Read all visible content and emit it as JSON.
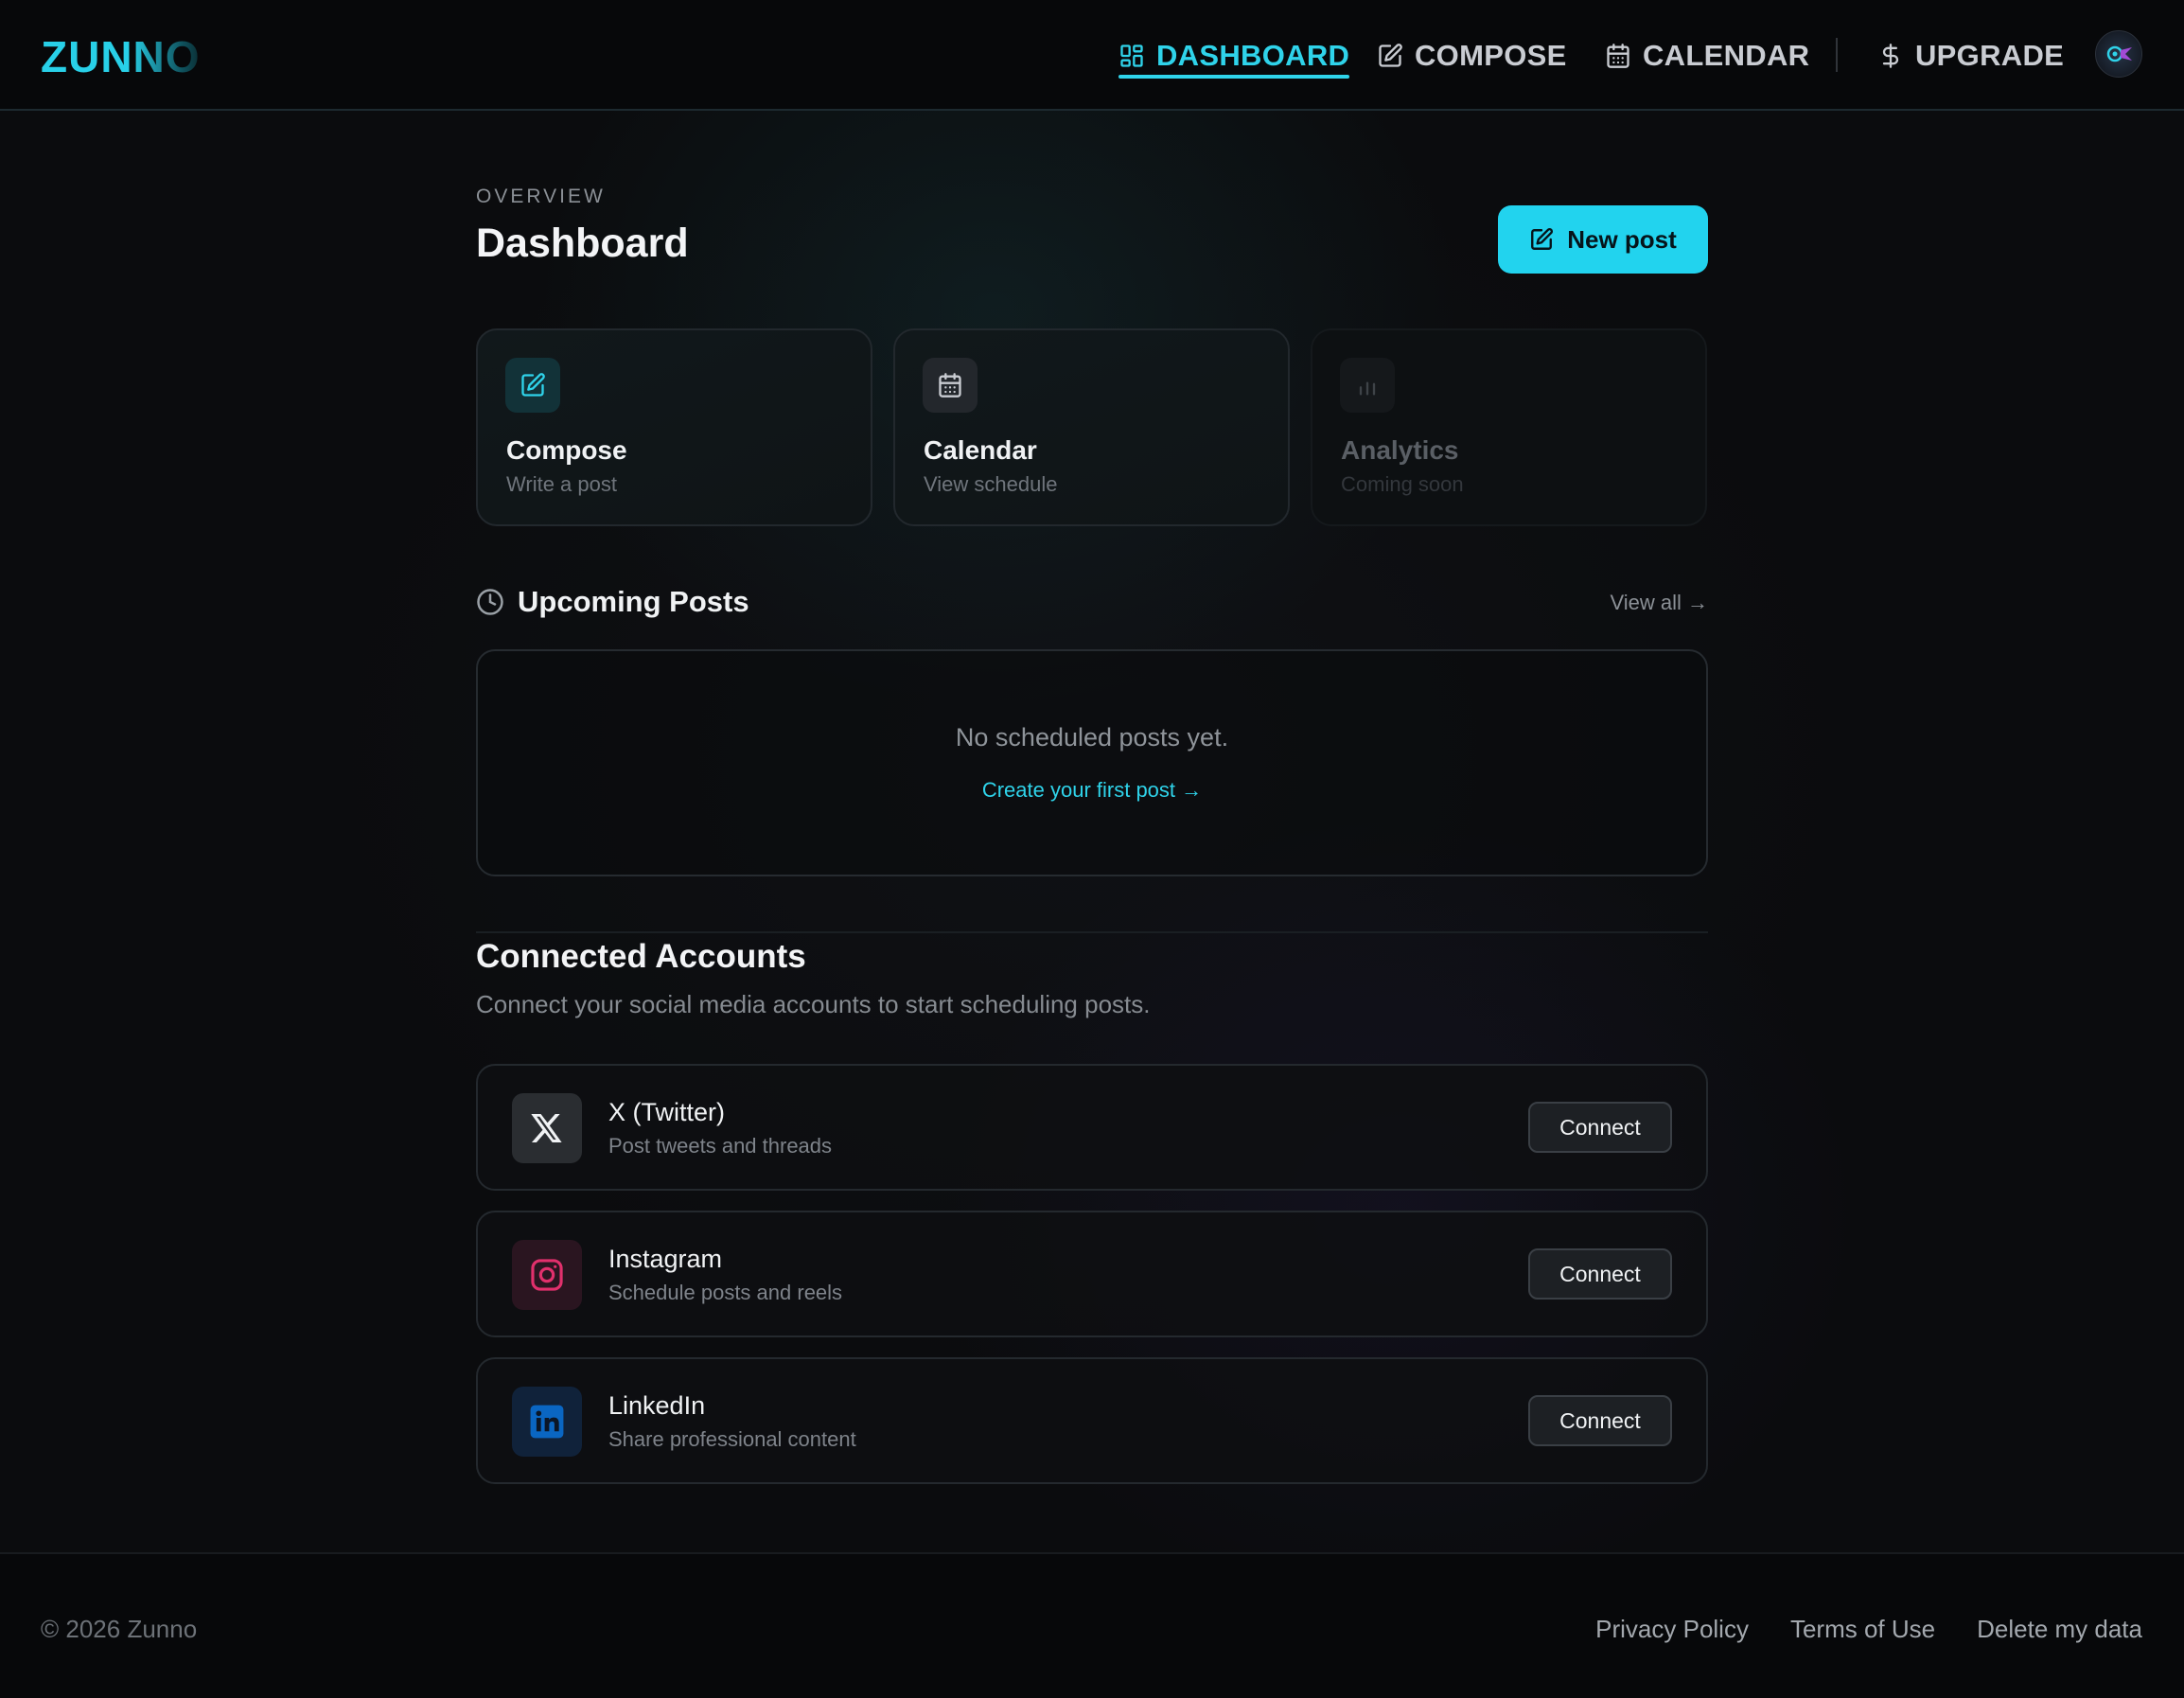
{
  "brand": {
    "logo": "ZUNNO"
  },
  "nav": {
    "items": [
      {
        "label": "DASHBOARD",
        "icon": "grid-icon",
        "active": true
      },
      {
        "label": "COMPOSE",
        "icon": "pencil-square-icon",
        "active": false
      },
      {
        "label": "CALENDAR",
        "icon": "calendar-icon",
        "active": false
      },
      {
        "label": "UPGRADE",
        "icon": "dollar-icon",
        "active": false
      }
    ],
    "avatar": "avatar"
  },
  "header": {
    "overline": "OVERVIEW",
    "title": "Dashboard",
    "new_post_label": "New post"
  },
  "cards": [
    {
      "title": "Compose",
      "subtitle": "Write a post",
      "icon": "pencil-square-icon"
    },
    {
      "title": "Calendar",
      "subtitle": "View schedule",
      "icon": "calendar-icon"
    },
    {
      "title": "Analytics",
      "subtitle": "Coming soon",
      "icon": "bar-chart-icon",
      "disabled": true
    }
  ],
  "upcoming": {
    "title": "Upcoming Posts",
    "view_all": "View all →",
    "empty_text": "No scheduled posts yet.",
    "empty_link": "Create your first post →"
  },
  "accounts": {
    "title": "Connected Accounts",
    "subtitle": "Connect your social media accounts to start scheduling posts.",
    "items": [
      {
        "name": "X (Twitter)",
        "description": "Post tweets and threads",
        "button": "Connect",
        "icon": "x-logo-icon"
      },
      {
        "name": "Instagram",
        "description": "Schedule posts and reels",
        "button": "Connect",
        "icon": "instagram-icon"
      },
      {
        "name": "LinkedIn",
        "description": "Share professional content",
        "button": "Connect",
        "icon": "linkedin-icon"
      }
    ]
  },
  "footer": {
    "copyright": "© 2026 Zunno",
    "links": [
      "Privacy Policy",
      "Terms of Use",
      "Delete my data"
    ]
  },
  "colors": {
    "accent": "#22d3ee",
    "background": "#0b0c0e",
    "instagram": "#e1306c",
    "linkedin": "#0a66c2"
  }
}
